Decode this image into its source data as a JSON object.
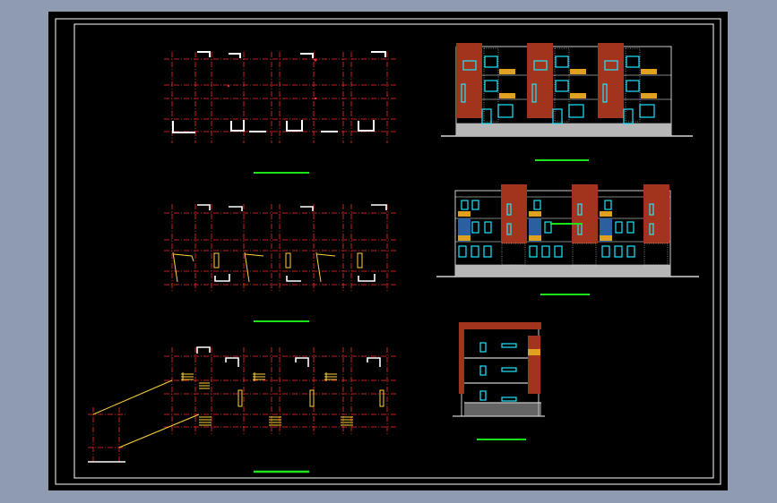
{
  "colors": {
    "background": "#8f9bb0",
    "canvas": "#000000",
    "frame": "#ffffff",
    "axis": "#ff2a2a",
    "wall": "#ffffff",
    "stair": "#ffd23a",
    "brick": "#a2331d",
    "window": "#20e6ff",
    "balcony": "#e0a020",
    "stone": "#b7b7b7",
    "title_line": "#19e619"
  },
  "views": [
    {
      "id": "floor-plan-1",
      "kind": "plan"
    },
    {
      "id": "floor-plan-2",
      "kind": "plan"
    },
    {
      "id": "floor-plan-3",
      "kind": "plan"
    },
    {
      "id": "front-elevation",
      "kind": "elevation"
    },
    {
      "id": "rear-elevation",
      "kind": "elevation"
    },
    {
      "id": "section",
      "kind": "section"
    }
  ]
}
